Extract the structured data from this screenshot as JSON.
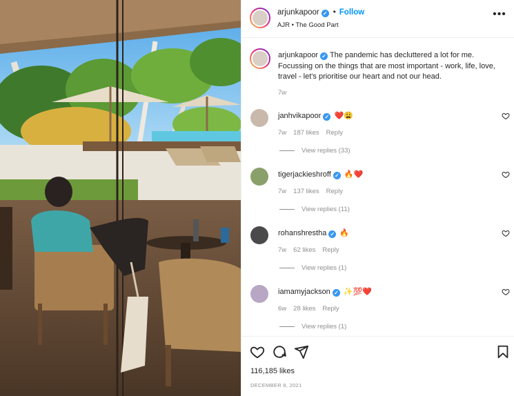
{
  "post": {
    "username": "arjunkapoor",
    "follow_label": "Follow",
    "dot": "•",
    "location": "AJR • The Good Part",
    "caption_username": "arjunkapoor",
    "caption_text": "The pandemic has decluttered a lot for me. Focussing on the things that are most important - work, life, love, travel - let's prioritise our heart and not our head.",
    "caption_time": "7w",
    "likes": "116,185 likes",
    "date": "DECEMBER 8, 2021"
  },
  "comments": [
    {
      "username": "janhvikapoor",
      "emoji": "❤️😩",
      "time": "7w",
      "likes": "187 likes",
      "reply": "Reply",
      "replies": "View replies (33)"
    },
    {
      "username": "tigerjackieshroff",
      "emoji": "🔥❤️",
      "time": "7w",
      "likes": "137 likes",
      "reply": "Reply",
      "replies": "View replies (11)"
    },
    {
      "username": "rohanshrestha",
      "emoji": "🔥",
      "time": "7w",
      "likes": "62 likes",
      "reply": "Reply",
      "replies": "View replies (1)"
    },
    {
      "username": "iamamyjackson",
      "emoji": "✨💯❤️",
      "time": "6w",
      "likes": "28 likes",
      "reply": "Reply",
      "replies": "View replies (1)"
    }
  ],
  "icons": {
    "more": "more-options-icon",
    "like": "heart-icon",
    "comment": "comment-icon",
    "share": "share-icon",
    "save": "bookmark-icon",
    "verified": "verified-badge-icon"
  },
  "colors": {
    "accent": "#0095f6",
    "verified": "#3897f0",
    "heart_red": "#ed4956",
    "muted": "#8e8e8e"
  }
}
